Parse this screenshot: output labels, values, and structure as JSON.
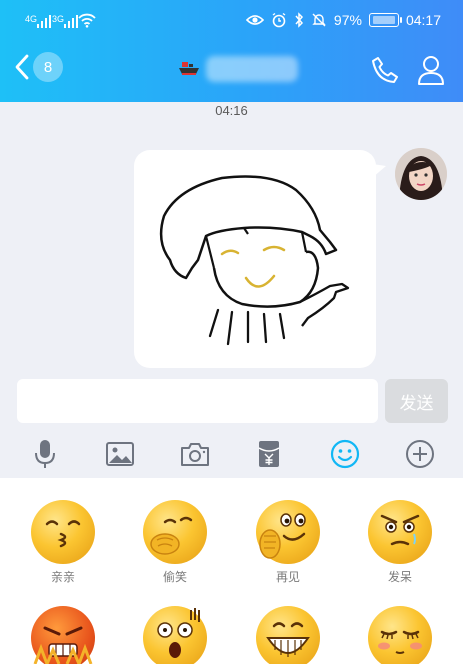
{
  "status": {
    "net1": "4G",
    "net2": "3G",
    "battery_percent": "97%",
    "time": "04:17"
  },
  "nav": {
    "unread_badge": "8"
  },
  "chat": {
    "timestamp": "04:16"
  },
  "input": {
    "send_label": "发送"
  },
  "toolbar": {
    "icons": [
      "microphone-icon",
      "image-icon",
      "camera-icon",
      "red-packet-icon",
      "emoji-icon",
      "plus-icon"
    ]
  },
  "emoji_panel": {
    "items": [
      {
        "label": "亲亲"
      },
      {
        "label": "偷笑"
      },
      {
        "label": "再见"
      },
      {
        "label": "发呆"
      }
    ]
  },
  "colors": {
    "header_start": "#1ec0f7",
    "header_end": "#3f8cf8",
    "accent": "#12b7f5"
  }
}
